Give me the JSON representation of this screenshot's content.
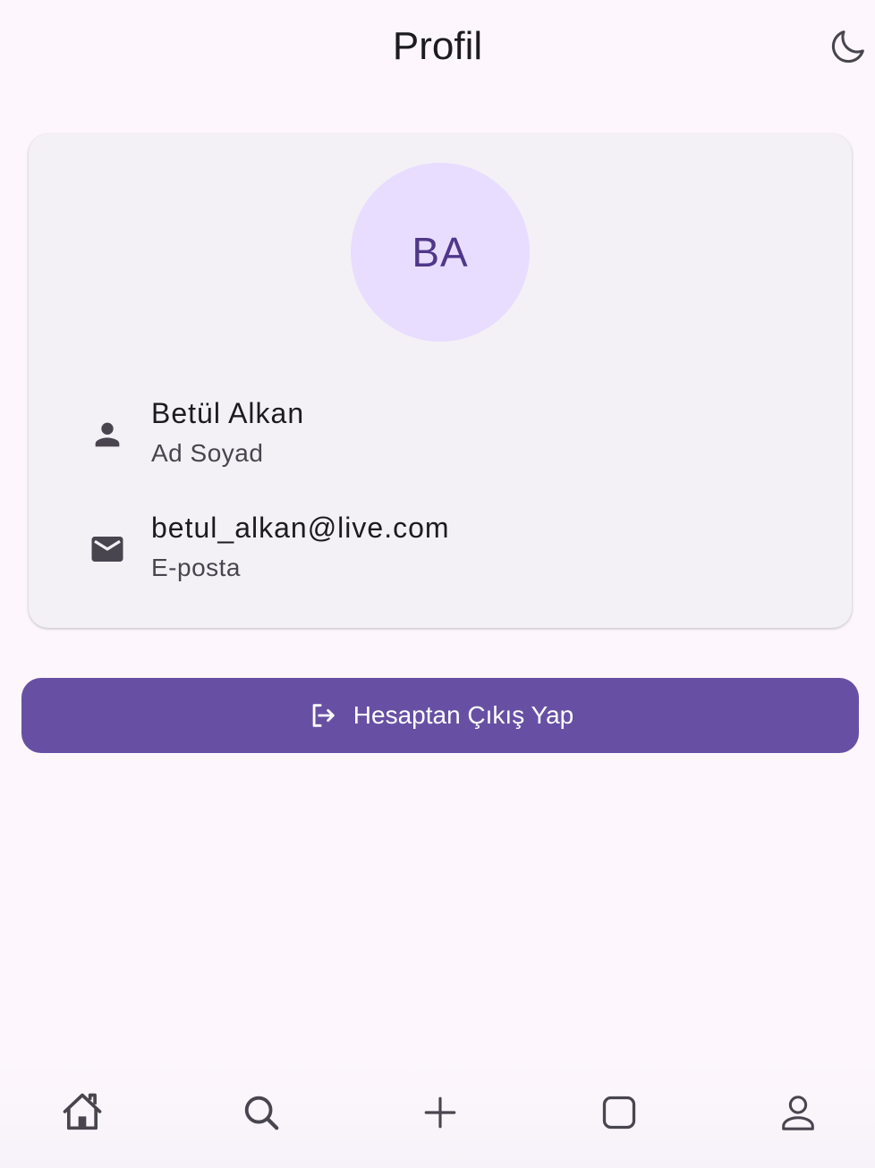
{
  "appbar": {
    "title": "Profil",
    "theme_toggle_icon": "moon-icon"
  },
  "profile": {
    "avatar_initials": "BA",
    "avatar_bg": "#e8ddff",
    "avatar_fg": "#4f378a",
    "name": {
      "value": "Betül Alkan",
      "label": "Ad Soyad",
      "icon": "person-icon"
    },
    "email": {
      "value": "betul_alkan@live.com",
      "label": "E-posta",
      "icon": "mail-icon"
    }
  },
  "logout_button": {
    "label": "Hesaptan Çıkış Yap",
    "icon": "logout-icon",
    "color": "#6750a4"
  },
  "bottom_nav": {
    "items": [
      {
        "icon": "home-icon"
      },
      {
        "icon": "search-icon"
      },
      {
        "icon": "add-icon"
      },
      {
        "icon": "square-icon"
      },
      {
        "icon": "profile-icon"
      }
    ]
  }
}
